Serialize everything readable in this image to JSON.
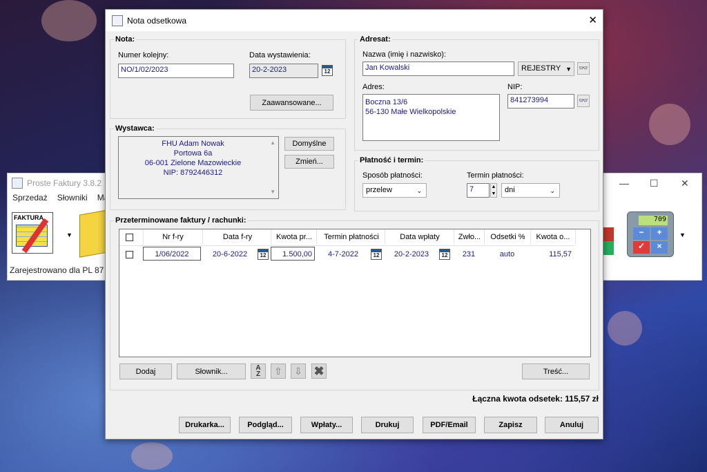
{
  "background_app": {
    "title": "Proste Faktury 3.8.2",
    "menu": [
      "Sprzedaż",
      "Słowniki",
      "Ma"
    ],
    "toolbar_label": "FAKTURA",
    "status": "Zarejestrowano dla PL 87",
    "calculator_display": "709"
  },
  "dialog": {
    "title": "Nota odsetkowa",
    "close_label": "✕"
  },
  "nota": {
    "group_title": "Nota:",
    "number_label": "Numer kolejny:",
    "number_value": "NO/1/02/2023",
    "date_label": "Data wystawienia:",
    "date_value": "20-2-2023",
    "advanced_button": "Zaawansowane..."
  },
  "wystawca": {
    "group_title": "Wystawca:",
    "lines": [
      "FHU Adam Nowak",
      "Portowa 6a",
      "06-001 Zielone Mazowieckie",
      "NIP: 8792446312"
    ],
    "default_button": "Domyślne",
    "change_button": "Zmień..."
  },
  "adresat": {
    "group_title": "Adresat:",
    "name_label": "Nazwa (imię i nazwisko):",
    "name_value": "Jan Kowalski",
    "registers_button": "REJESTRY",
    "address_label": "Adres:",
    "address_lines": [
      "Boczna 13/6",
      "56-130 Małe Wielkopolskie"
    ],
    "nip_label": "NIP:",
    "nip_value": "841273994"
  },
  "platnosc": {
    "group_title": "Płatność i termin:",
    "method_label": "Sposób płatności:",
    "method_value": "przelew",
    "term_label": "Termin płatności:",
    "term_value": "7",
    "term_unit": "dni"
  },
  "invoices": {
    "group_title": "Przeterminowane faktury / rachunki:",
    "columns": [
      "Nr f-ry",
      "Data f-ry",
      "Kwota pr...",
      "Termin płatności",
      "Data wpłaty",
      "Zwło...",
      "Odsetki %",
      "Kwota o..."
    ],
    "rows": [
      {
        "nr": "1/06/2022",
        "data": "20-6-2022",
        "kwota": "1.500,00",
        "termin": "4-7-2022",
        "wplata": "20-2-2023",
        "zwloka": "231",
        "odsetki": "auto",
        "kwota_o": "115,57"
      }
    ],
    "add_button": "Dodaj",
    "dictionary_button": "Słownik...",
    "content_button": "Treść..."
  },
  "total": "Łączna kwota odsetek: 115,57 zł",
  "footer": {
    "print_setup": "Drukarka...",
    "preview": "Podgląd...",
    "payments": "Wpłaty...",
    "print": "Drukuj",
    "pdf_email": "PDF/Email",
    "save": "Zapisz",
    "cancel": "Anuluj"
  },
  "calendar_icon_text": "12"
}
